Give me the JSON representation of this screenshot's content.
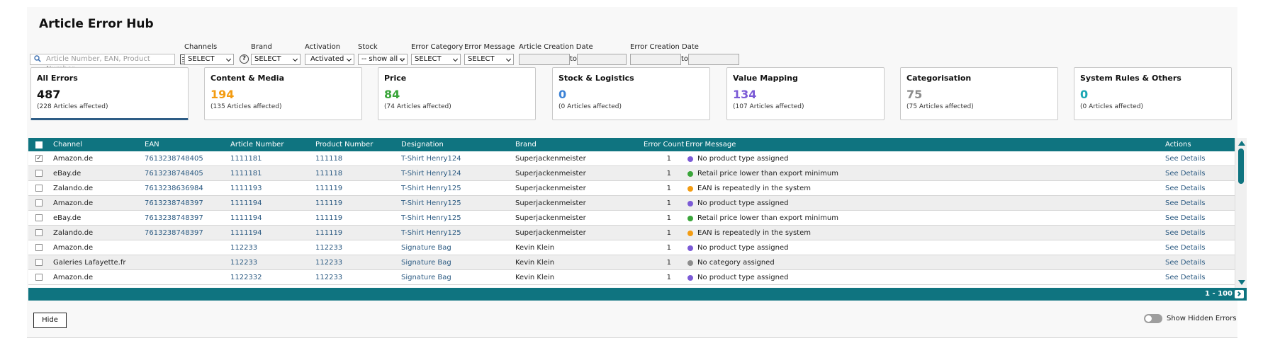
{
  "page": {
    "title": "Article Error Hub"
  },
  "search": {
    "placeholder": "Article Number, EAN, Product Number"
  },
  "filters": {
    "channels": {
      "label": "Channels",
      "value": "SELECT"
    },
    "brand": {
      "label": "Brand",
      "value": "SELECT"
    },
    "activation": {
      "label": "Activation",
      "value": "Activated"
    },
    "stock": {
      "label": "Stock",
      "value": "-- show all --"
    },
    "error_category": {
      "label": "Error Category",
      "value": "SELECT"
    },
    "error_message": {
      "label": "Error Message",
      "value": "SELECT"
    },
    "article_creation_date": {
      "label": "Article Creation Date",
      "to": "to"
    },
    "error_creation_date": {
      "label": "Error Creation Date",
      "to": "to"
    }
  },
  "cards": [
    {
      "label": "All Errors",
      "count": "487",
      "sub": "(228 Articles affected)",
      "color": "#111111"
    },
    {
      "label": "Content & Media",
      "count": "194",
      "sub": "(135 Articles affected)",
      "color": "#f39c12"
    },
    {
      "label": "Price",
      "count": "84",
      "sub": "(74 Articles affected)",
      "color": "#3aa53a"
    },
    {
      "label": "Stock & Logistics",
      "count": "0",
      "sub": "(0 Articles affected)",
      "color": "#3b82d6"
    },
    {
      "label": "Value Mapping",
      "count": "134",
      "sub": "(107 Articles affected)",
      "color": "#7b5ad6"
    },
    {
      "label": "Categorisation",
      "count": "75",
      "sub": "(75 Articles affected)",
      "color": "#8c8c8c"
    },
    {
      "label": "System Rules & Others",
      "count": "0",
      "sub": "(0 Articles affected)",
      "color": "#1aa6b3"
    }
  ],
  "table": {
    "headers": {
      "channel": "Channel",
      "ean": "EAN",
      "article_number": "Article Number",
      "product_number": "Product Number",
      "designation": "Designation",
      "brand": "Brand",
      "error_count": "Error Count",
      "error_message": "Error Message",
      "actions": "Actions"
    },
    "rows": [
      {
        "checked": true,
        "channel": "Amazon.de",
        "ean": "7613238748405",
        "article": "1111181",
        "product": "111118",
        "designation": "T-Shirt Henry124",
        "brand": "Superjackenmeister",
        "count": "1",
        "dot": "#7b5ad6",
        "message": "No product type assigned",
        "action": "See Details"
      },
      {
        "checked": false,
        "channel": "eBay.de",
        "ean": "7613238748405",
        "article": "1111181",
        "product": "111118",
        "designation": "T-Shirt Henry124",
        "brand": "Superjackenmeister",
        "count": "1",
        "dot": "#3aa53a",
        "message": "Retail price lower than export minimum",
        "action": "See Details"
      },
      {
        "checked": false,
        "channel": "Zalando.de",
        "ean": "7613238636984",
        "article": "1111193",
        "product": "111119",
        "designation": "T-Shirt Henry125",
        "brand": "Superjackenmeister",
        "count": "1",
        "dot": "#f39c12",
        "message": "EAN is repeatedly in the system",
        "action": "See Details"
      },
      {
        "checked": false,
        "channel": "Amazon.de",
        "ean": "7613238748397",
        "article": "1111194",
        "product": "111119",
        "designation": "T-Shirt Henry125",
        "brand": "Superjackenmeister",
        "count": "1",
        "dot": "#7b5ad6",
        "message": "No product type assigned",
        "action": "See Details"
      },
      {
        "checked": false,
        "channel": "eBay.de",
        "ean": "7613238748397",
        "article": "1111194",
        "product": "111119",
        "designation": "T-Shirt Henry125",
        "brand": "Superjackenmeister",
        "count": "1",
        "dot": "#3aa53a",
        "message": "Retail price lower than export minimum",
        "action": "See Details"
      },
      {
        "checked": false,
        "channel": "Zalando.de",
        "ean": "7613238748397",
        "article": "1111194",
        "product": "111119",
        "designation": "T-Shirt Henry125",
        "brand": "Superjackenmeister",
        "count": "1",
        "dot": "#f39c12",
        "message": "EAN is repeatedly in the system",
        "action": "See Details"
      },
      {
        "checked": false,
        "channel": "Amazon.de",
        "ean": "",
        "article": "112233",
        "product": "112233",
        "designation": "Signature Bag",
        "brand": "Kevin Klein",
        "count": "1",
        "dot": "#7b5ad6",
        "message": "No product type assigned",
        "action": "See Details"
      },
      {
        "checked": false,
        "channel": "Galeries Lafayette.fr",
        "ean": "",
        "article": "112233",
        "product": "112233",
        "designation": "Signature Bag",
        "brand": "Kevin Klein",
        "count": "1",
        "dot": "#8c8c8c",
        "message": "No category assigned",
        "action": "See Details"
      },
      {
        "checked": false,
        "channel": "Amazon.de",
        "ean": "",
        "article": "1122332",
        "product": "112233",
        "designation": "Signature Bag",
        "brand": "Kevin Klein",
        "count": "1",
        "dot": "#7b5ad6",
        "message": "No product type assigned",
        "action": "See Details"
      }
    ],
    "pagination": "1 - 100"
  },
  "footer": {
    "hide_label": "Hide",
    "toggle_label": "Show Hidden Errors"
  },
  "icons": {
    "search": "search-icon",
    "list": "list-icon",
    "help": "help-icon",
    "next": "chevron-right-icon"
  },
  "colors": {
    "header": "#0f7480",
    "link": "#2b5a82"
  }
}
